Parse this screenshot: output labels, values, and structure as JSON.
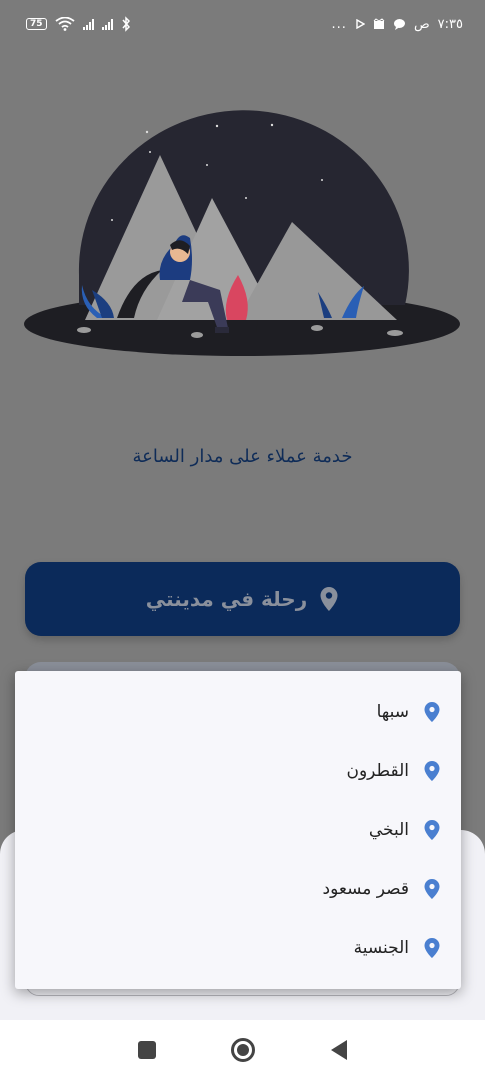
{
  "status_bar": {
    "battery": "75",
    "time": "٧:٣٥",
    "am_pm": "ص",
    "dots": "..."
  },
  "main": {
    "tagline": "خدمة عملاء على مدار الساعة",
    "primary_button_label": "رحلة في مدينتي"
  },
  "dropdown": {
    "items": [
      {
        "label": "سبها"
      },
      {
        "label": "القطرون"
      },
      {
        "label": "البخي"
      },
      {
        "label": "قصر مسعود"
      },
      {
        "label": "الجنسية"
      }
    ]
  },
  "colors": {
    "primary": "#0b2a5a",
    "pin": "#4a7fd0",
    "scrim": "#7b7b7b"
  }
}
